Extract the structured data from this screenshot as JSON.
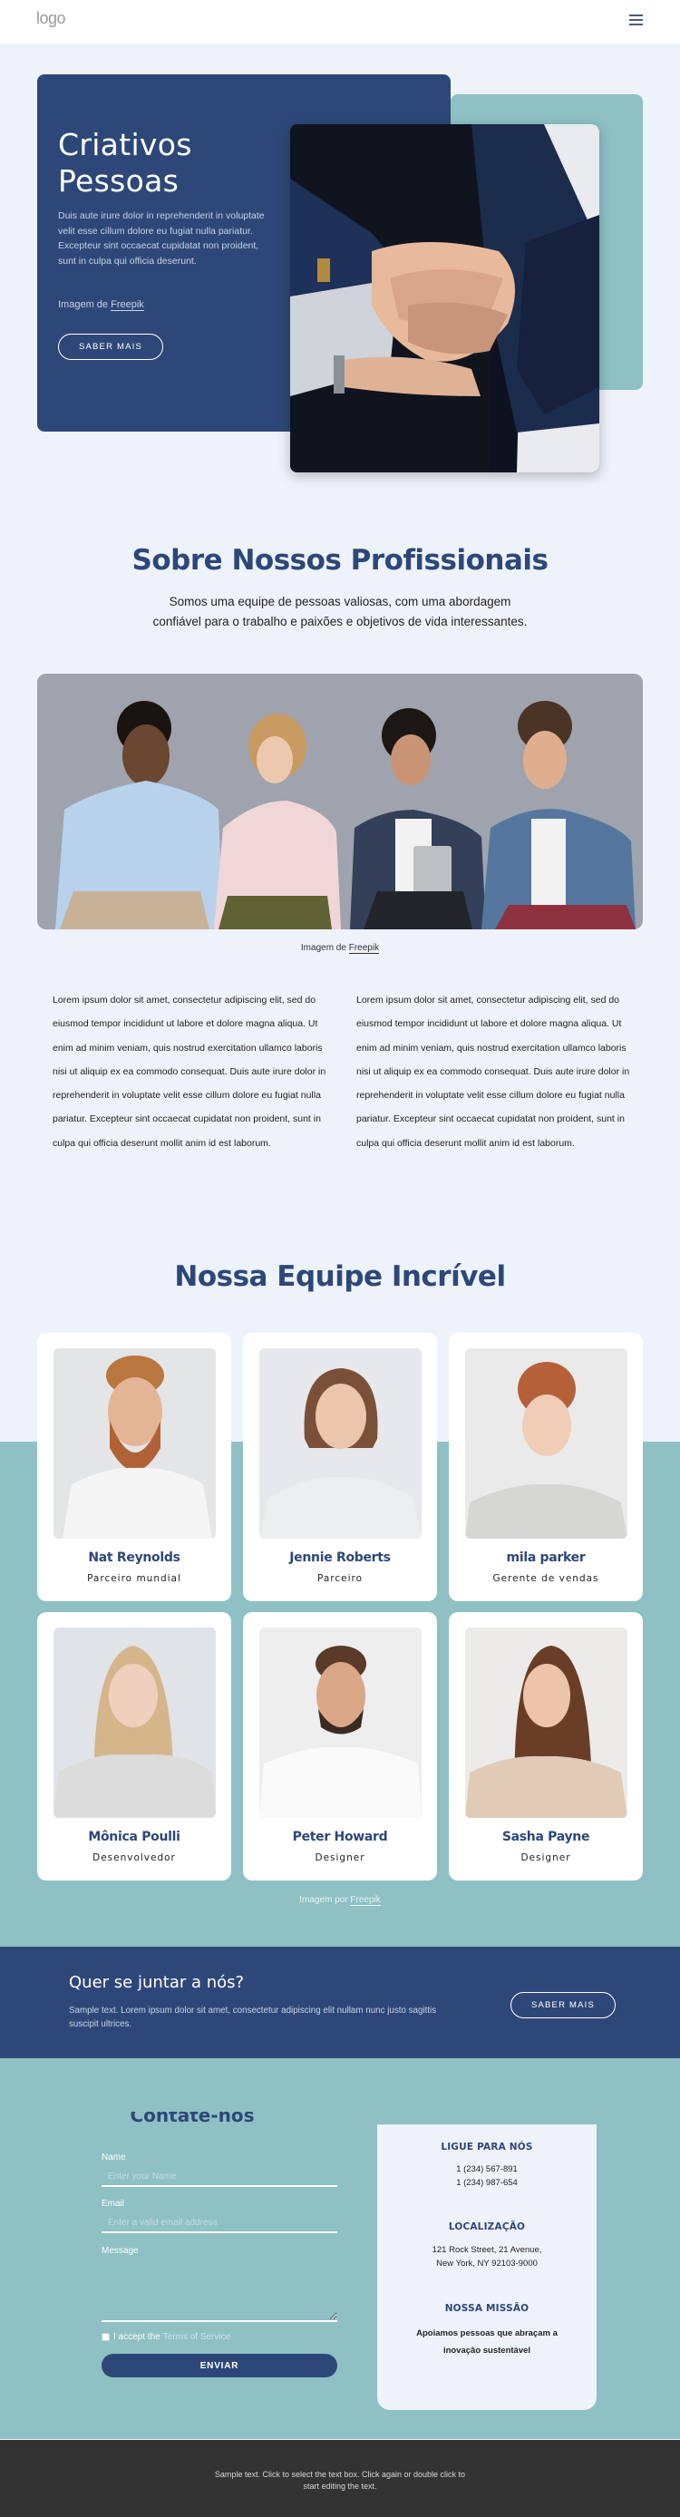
{
  "header": {
    "logo": "logo",
    "menu_icon": "hamburger-menu-icon"
  },
  "hero": {
    "title_line1": "Criativos",
    "title_line2": "Pessoas",
    "text": "Duis aute irure dolor in reprehenderit in voluptate velit esse cillum dolore eu fugiat nulla pariatur. Excepteur sint occaecat cupidatat non proident, sunt in culpa qui officia deserunt.",
    "credit_prefix": "Imagem de",
    "credit_link": "Freepik",
    "button_label": "SABER MAIS",
    "image": "team-hands-stacked-photo"
  },
  "about": {
    "title": "Sobre Nossos Profissionais",
    "subtitle": "Somos uma equipe de pessoas valiosas, com uma abordagem confiável para o trabalho e paixões e objetivos de vida interessantes.",
    "image": "group-of-four-people-photo",
    "caption_prefix": "Imagem de",
    "caption_link": "Freepik",
    "paragraphs": [
      "Lorem ipsum dolor sit amet, consectetur adipiscing elit, sed do eiusmod tempor incididunt ut labore et dolore magna aliqua. Ut enim ad minim veniam, quis nostrud exercitation ullamco laboris nisi ut aliquip ex ea commodo consequat. Duis aute irure dolor in reprehenderit in voluptate velit esse cillum dolore eu fugiat nulla pariatur. Excepteur sint occaecat cupidatat non proident, sunt in culpa qui officia deserunt mollit anim id est laborum.",
      "Lorem ipsum dolor sit amet, consectetur adipiscing elit, sed do eiusmod tempor incididunt ut labore et dolore magna aliqua. Ut enim ad minim veniam, quis nostrud exercitation ullamco laboris nisi ut aliquip ex ea commodo consequat. Duis aute irure dolor in reprehenderit in voluptate velit esse cillum dolore eu fugiat nulla pariatur. Excepteur sint occaecat cupidatat non proident, sunt in culpa qui officia deserunt mollit anim id est laborum."
    ]
  },
  "team": {
    "title": "Nossa Equipe Incrível",
    "members": [
      {
        "name": "Nat Reynolds",
        "role": "Parceiro mundial"
      },
      {
        "name": "Jennie Roberts",
        "role": "Parceiro"
      },
      {
        "name": "mila parker",
        "role": "Gerente de vendas"
      },
      {
        "name": "Mônica Poulli",
        "role": "Desenvolvedor"
      },
      {
        "name": "Peter Howard",
        "role": "Designer"
      },
      {
        "name": "Sasha Payne",
        "role": "Designer"
      }
    ],
    "caption_prefix": "Imagem por",
    "caption_link": "Freepik"
  },
  "cta": {
    "title": "Quer se juntar a nós?",
    "text": "Sample text. Lorem ipsum dolor sit amet, consectetur adipiscing elit nullam nunc justo sagittis suscipit ultrices.",
    "button_label": "SABER MAIS"
  },
  "contact": {
    "title": "Contate-nos",
    "form": {
      "name_label": "Name",
      "name_placeholder": "Enter your Name",
      "email_label": "Email",
      "email_placeholder": "Enter a valid email address",
      "message_label": "Message",
      "accept_label": "I accept the",
      "terms_link": "Terms of Service",
      "submit_label": "ENVIAR"
    },
    "info": {
      "phone_heading": "LIGUE PARA NÓS",
      "phone_1": "1 (234) 567-891",
      "phone_2": "1 (234) 987-654",
      "location_heading": "LOCALIZAÇÃO",
      "address_1": "121 Rock Street, 21 Avenue,",
      "address_2": "New York, NY 92103-9000",
      "mission_heading": "NOSSA MISSÃO",
      "mission_1": "Apoiamos pessoas que abraçam a",
      "mission_2": "inovação sustentável"
    }
  },
  "footer": {
    "text": "Sample text. Click to select the text box. Click again or double click to start editing the text."
  },
  "colors": {
    "primary_blue": "#2d4878",
    "teal": "#8ec0c4",
    "page_bg": "#eef2fa",
    "footer_bg": "#333333"
  }
}
